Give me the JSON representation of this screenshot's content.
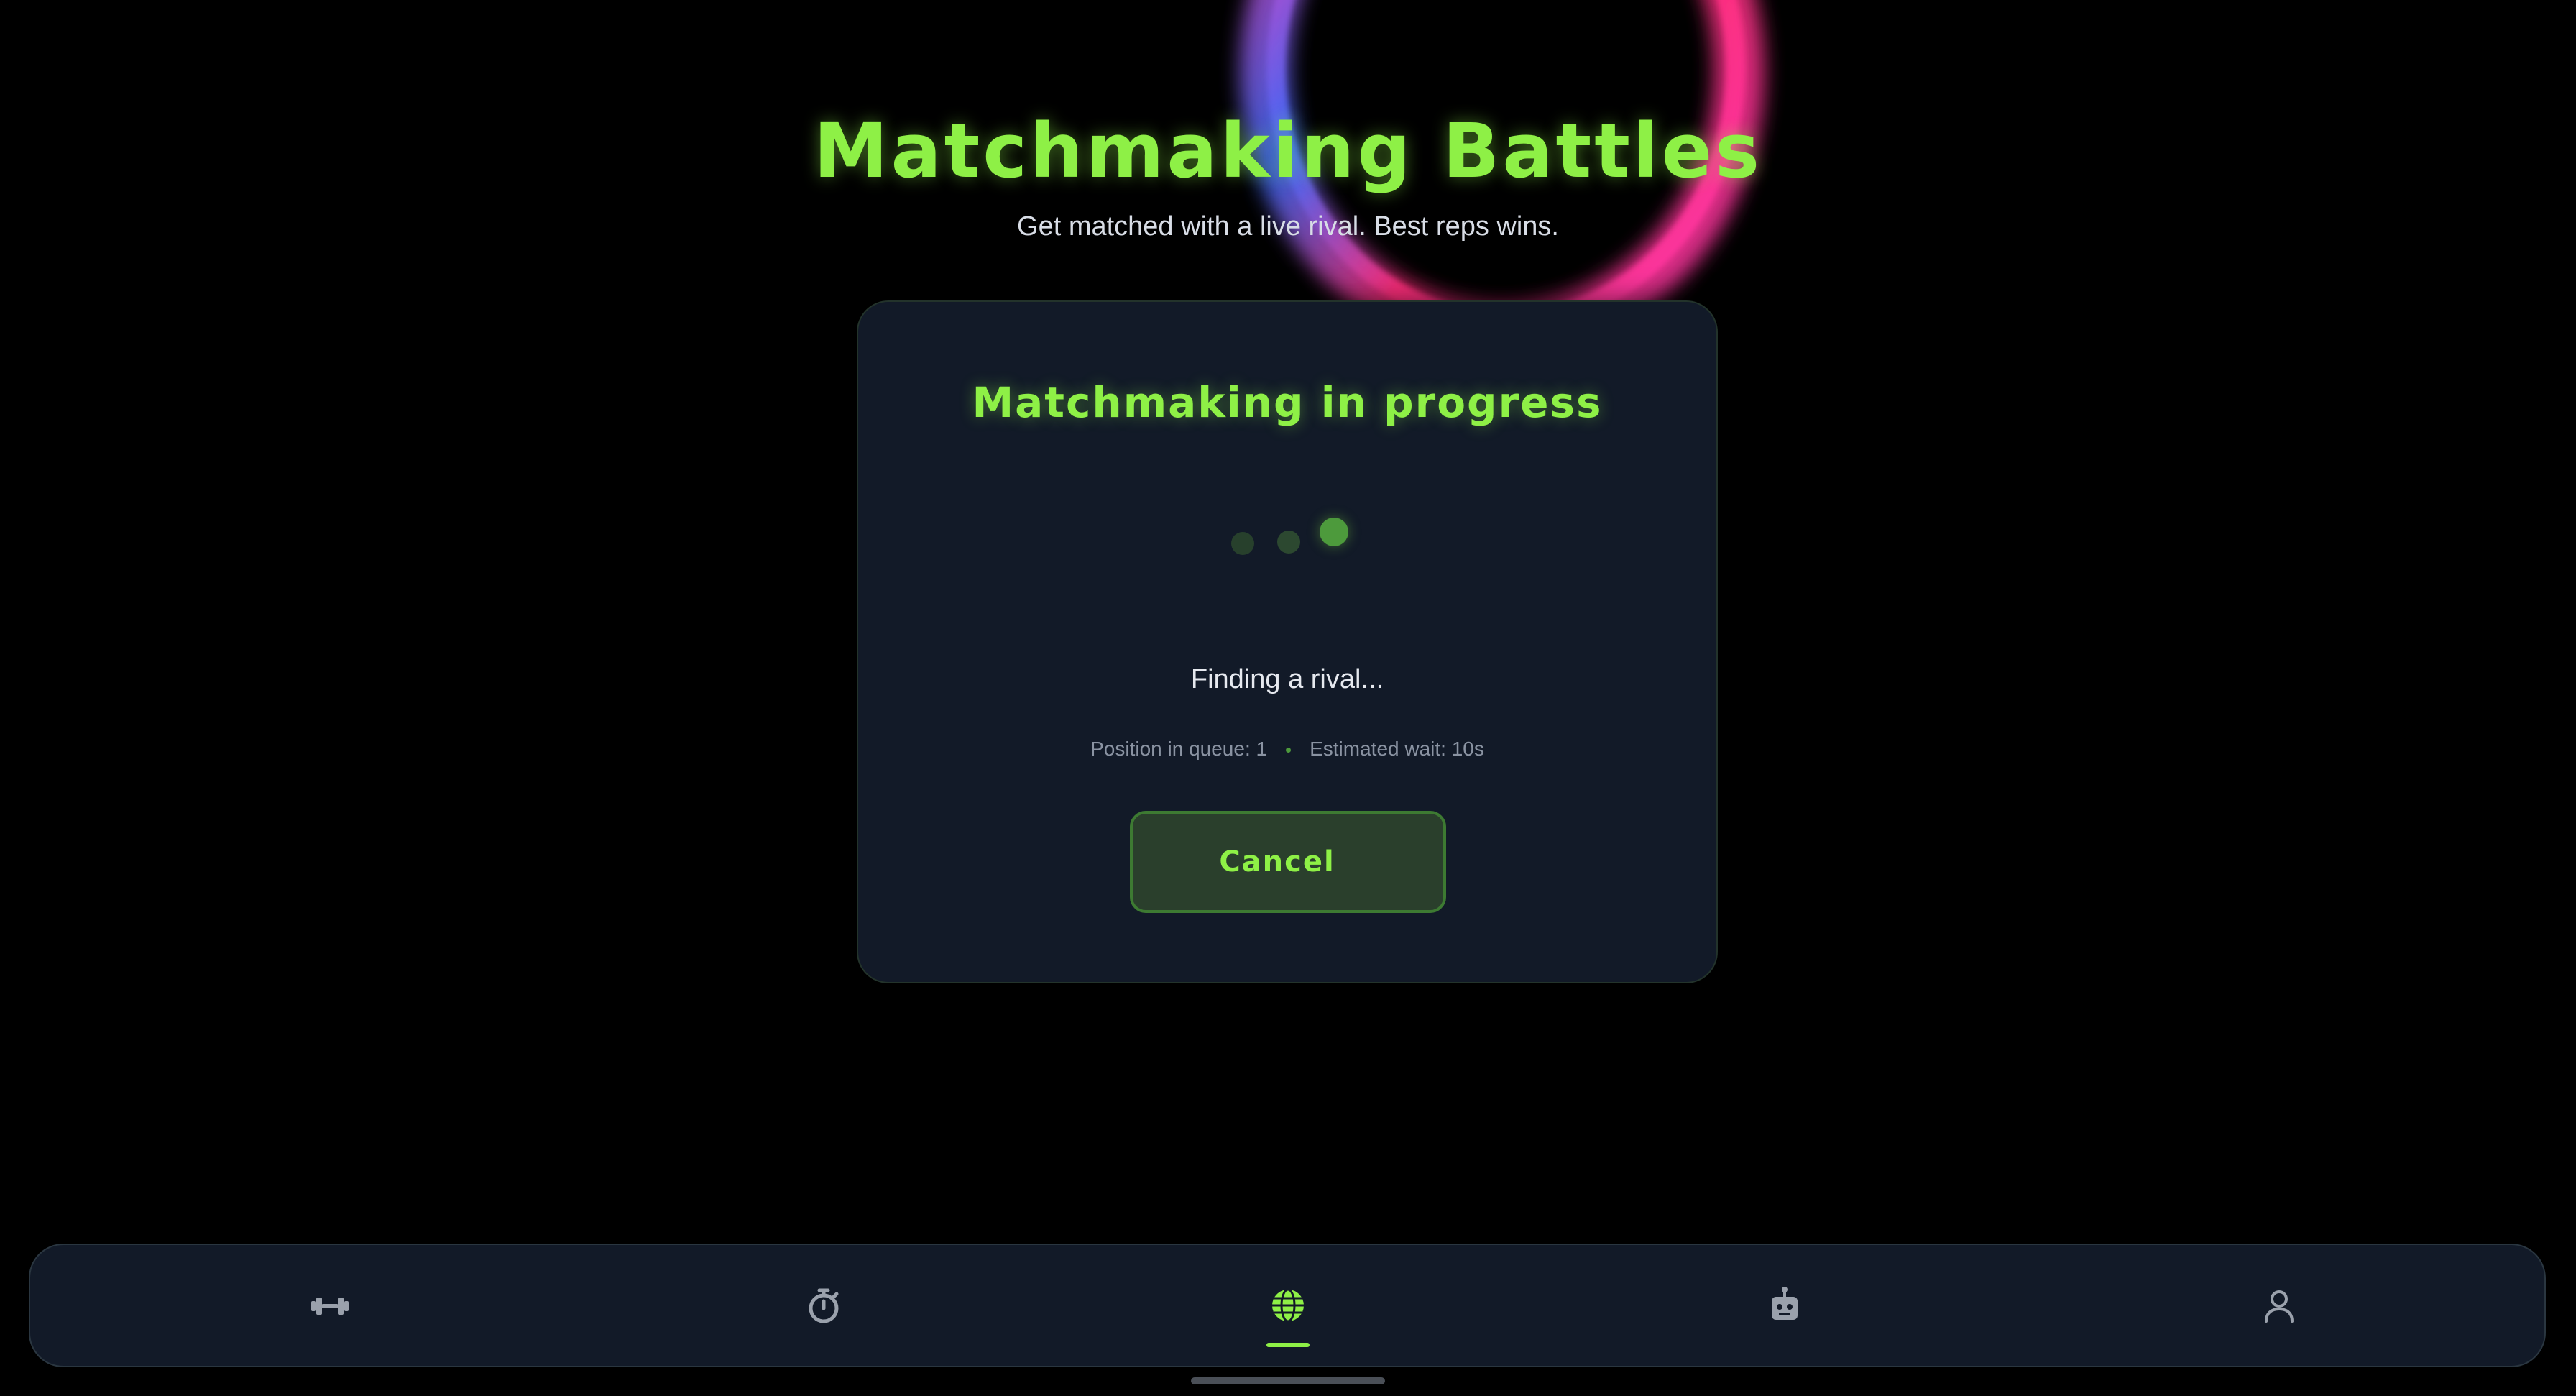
{
  "header": {
    "title": "Matchmaking Battles",
    "subtitle": "Get matched with a live rival. Best reps wins."
  },
  "card": {
    "title": "Matchmaking in progress",
    "status": "Finding a rival...",
    "queue_position": "Position in queue: 1",
    "estimated_wait": "Estimated wait: 10s",
    "cancel_label": "Cancel"
  },
  "tabbar": {
    "active_tab": "battles",
    "tabs": [
      {
        "id": "workouts",
        "icon": "dumbbell-icon"
      },
      {
        "id": "timer",
        "icon": "stopwatch-icon"
      },
      {
        "id": "battles",
        "icon": "globe-icon"
      },
      {
        "id": "ai-coach",
        "icon": "robot-icon"
      },
      {
        "id": "profile",
        "icon": "user-icon"
      }
    ]
  },
  "colors": {
    "accent": "#8ef046",
    "background": "#000000",
    "card": "#121a28",
    "icon_inactive": "#9aa1ac"
  }
}
